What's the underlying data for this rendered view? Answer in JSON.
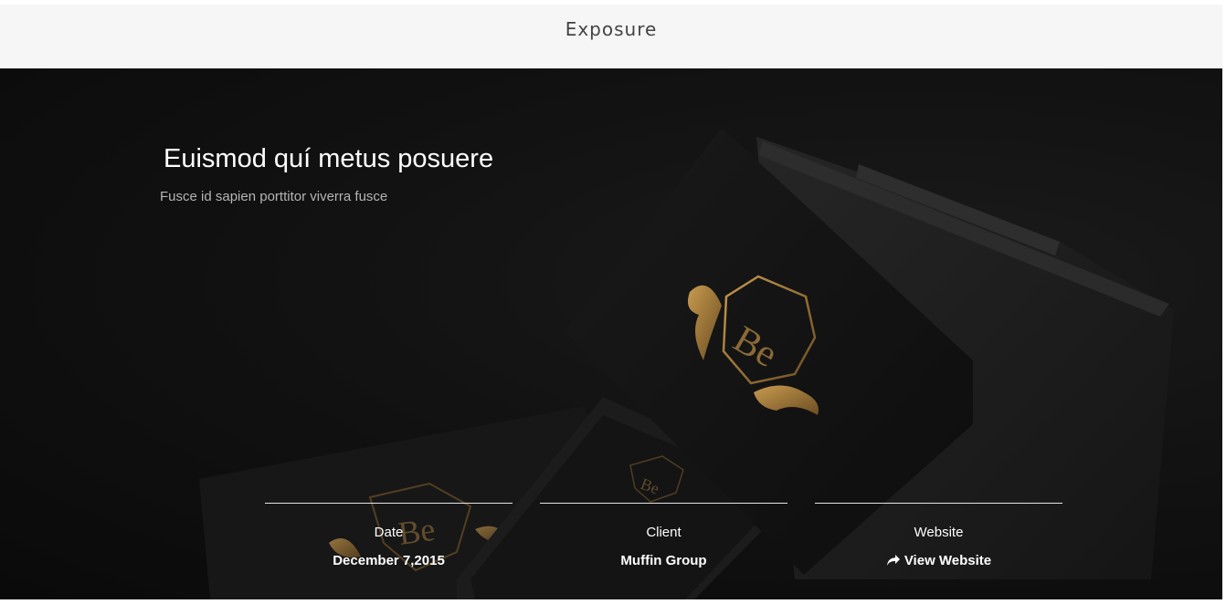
{
  "header": {
    "title": "Exposure"
  },
  "hero": {
    "heading": "Euismod quí metus posuere",
    "subheading": "Fusce id sapien porttitor viverra fusce",
    "image": {
      "logo_text": "Be",
      "accent_color": "#a07a3c"
    }
  },
  "details": [
    {
      "label": "Date",
      "value": "December 7,2015"
    },
    {
      "label": "Client",
      "value": "Muffin Group"
    },
    {
      "label": "Website",
      "value": "View Website",
      "icon": "share-arrow-icon"
    }
  ],
  "colors": {
    "top_bar": "#f6f6f6",
    "hero_bg": "#121212",
    "text": "#ffffff"
  }
}
